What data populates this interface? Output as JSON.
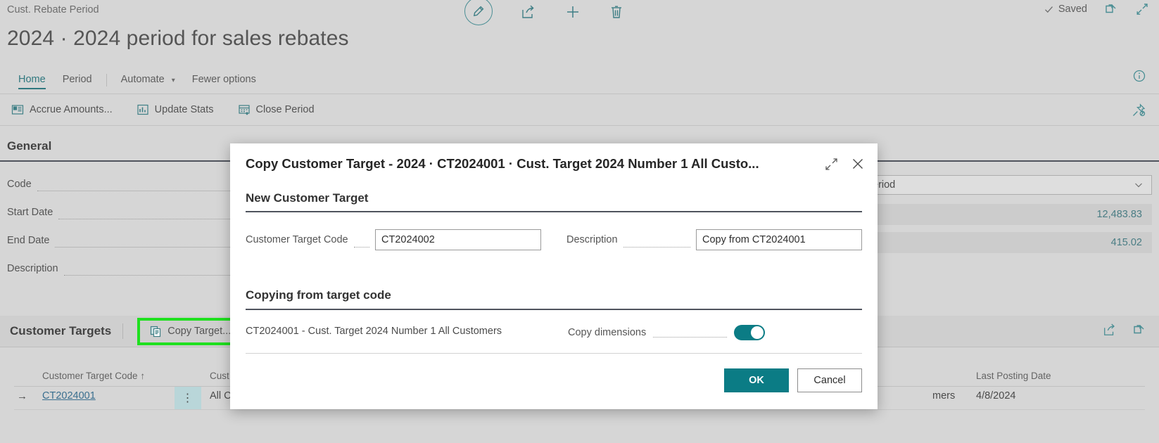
{
  "background": {
    "breadcrumb": "Cust. Rebate Period",
    "title": "2024 · 2024 period for sales rebates",
    "saved_label": "Saved",
    "top_icons": {
      "edit": "edit-pencil-icon",
      "share": "share-icon",
      "new": "add-icon",
      "delete": "delete-icon",
      "open_new_window": "open-in-new-window-icon",
      "collapse": "collapse-icon"
    },
    "tabs": [
      {
        "label": "Home",
        "active": true
      },
      {
        "label": "Period",
        "active": false
      },
      {
        "label": "Automate",
        "active": false,
        "has_chevron": true
      },
      {
        "label": "Fewer options",
        "active": false
      }
    ],
    "actions": [
      {
        "label": "Accrue Amounts...",
        "icon": "accrue-amounts-icon"
      },
      {
        "label": "Update Stats",
        "icon": "update-stats-icon"
      },
      {
        "label": "Close Period",
        "icon": "close-period-icon"
      }
    ],
    "general": {
      "heading": "General",
      "fields": [
        {
          "label": "Code"
        },
        {
          "label": "Start Date"
        },
        {
          "label": "End Date"
        },
        {
          "label": "Description"
        }
      ],
      "right_values": {
        "dropdown_value": "eriod",
        "value_1": "12,483.83",
        "value_2": "415.02"
      }
    },
    "subgrid": {
      "title": "Customer Targets",
      "copy_target_label": "Copy Target...",
      "copy_target_icon": "copy-icon",
      "share_icon": "share-icon",
      "open_in_excel_icon": "open-in-excel-icon",
      "columns": [
        {
          "label": "Customer Target Code ↑"
        },
        {
          "label": "Cust"
        },
        {
          "label": "Last Posting Date"
        }
      ],
      "rows": [
        {
          "row_arrow": "→",
          "code": "CT2024001",
          "menu": "⋮",
          "customer": "All C",
          "customer_tail": "mers",
          "last_posting_date": "4/8/2024"
        }
      ]
    }
  },
  "dialog": {
    "title": "Copy Customer Target - 2024 · CT2024001 · Cust. Target 2024 Number 1 All Custo...",
    "expand_icon": "expand-icon",
    "close_icon": "close-icon",
    "section_new": "New Customer Target",
    "customer_target_code": {
      "label": "Customer Target Code",
      "value": "CT2024002"
    },
    "description": {
      "label": "Description",
      "value": "Copy from CT2024001"
    },
    "section_copying": "Copying from target code",
    "source_target": "CT2024001 - Cust. Target 2024 Number 1 All Customers",
    "copy_dimensions": {
      "label": "Copy dimensions",
      "value": "on"
    },
    "ok_label": "OK",
    "cancel_label": "Cancel"
  },
  "colors": {
    "accent_teal": "#0b7c85",
    "highlight_green": "#1fe01f",
    "page_bg": "#d6d6d6"
  }
}
